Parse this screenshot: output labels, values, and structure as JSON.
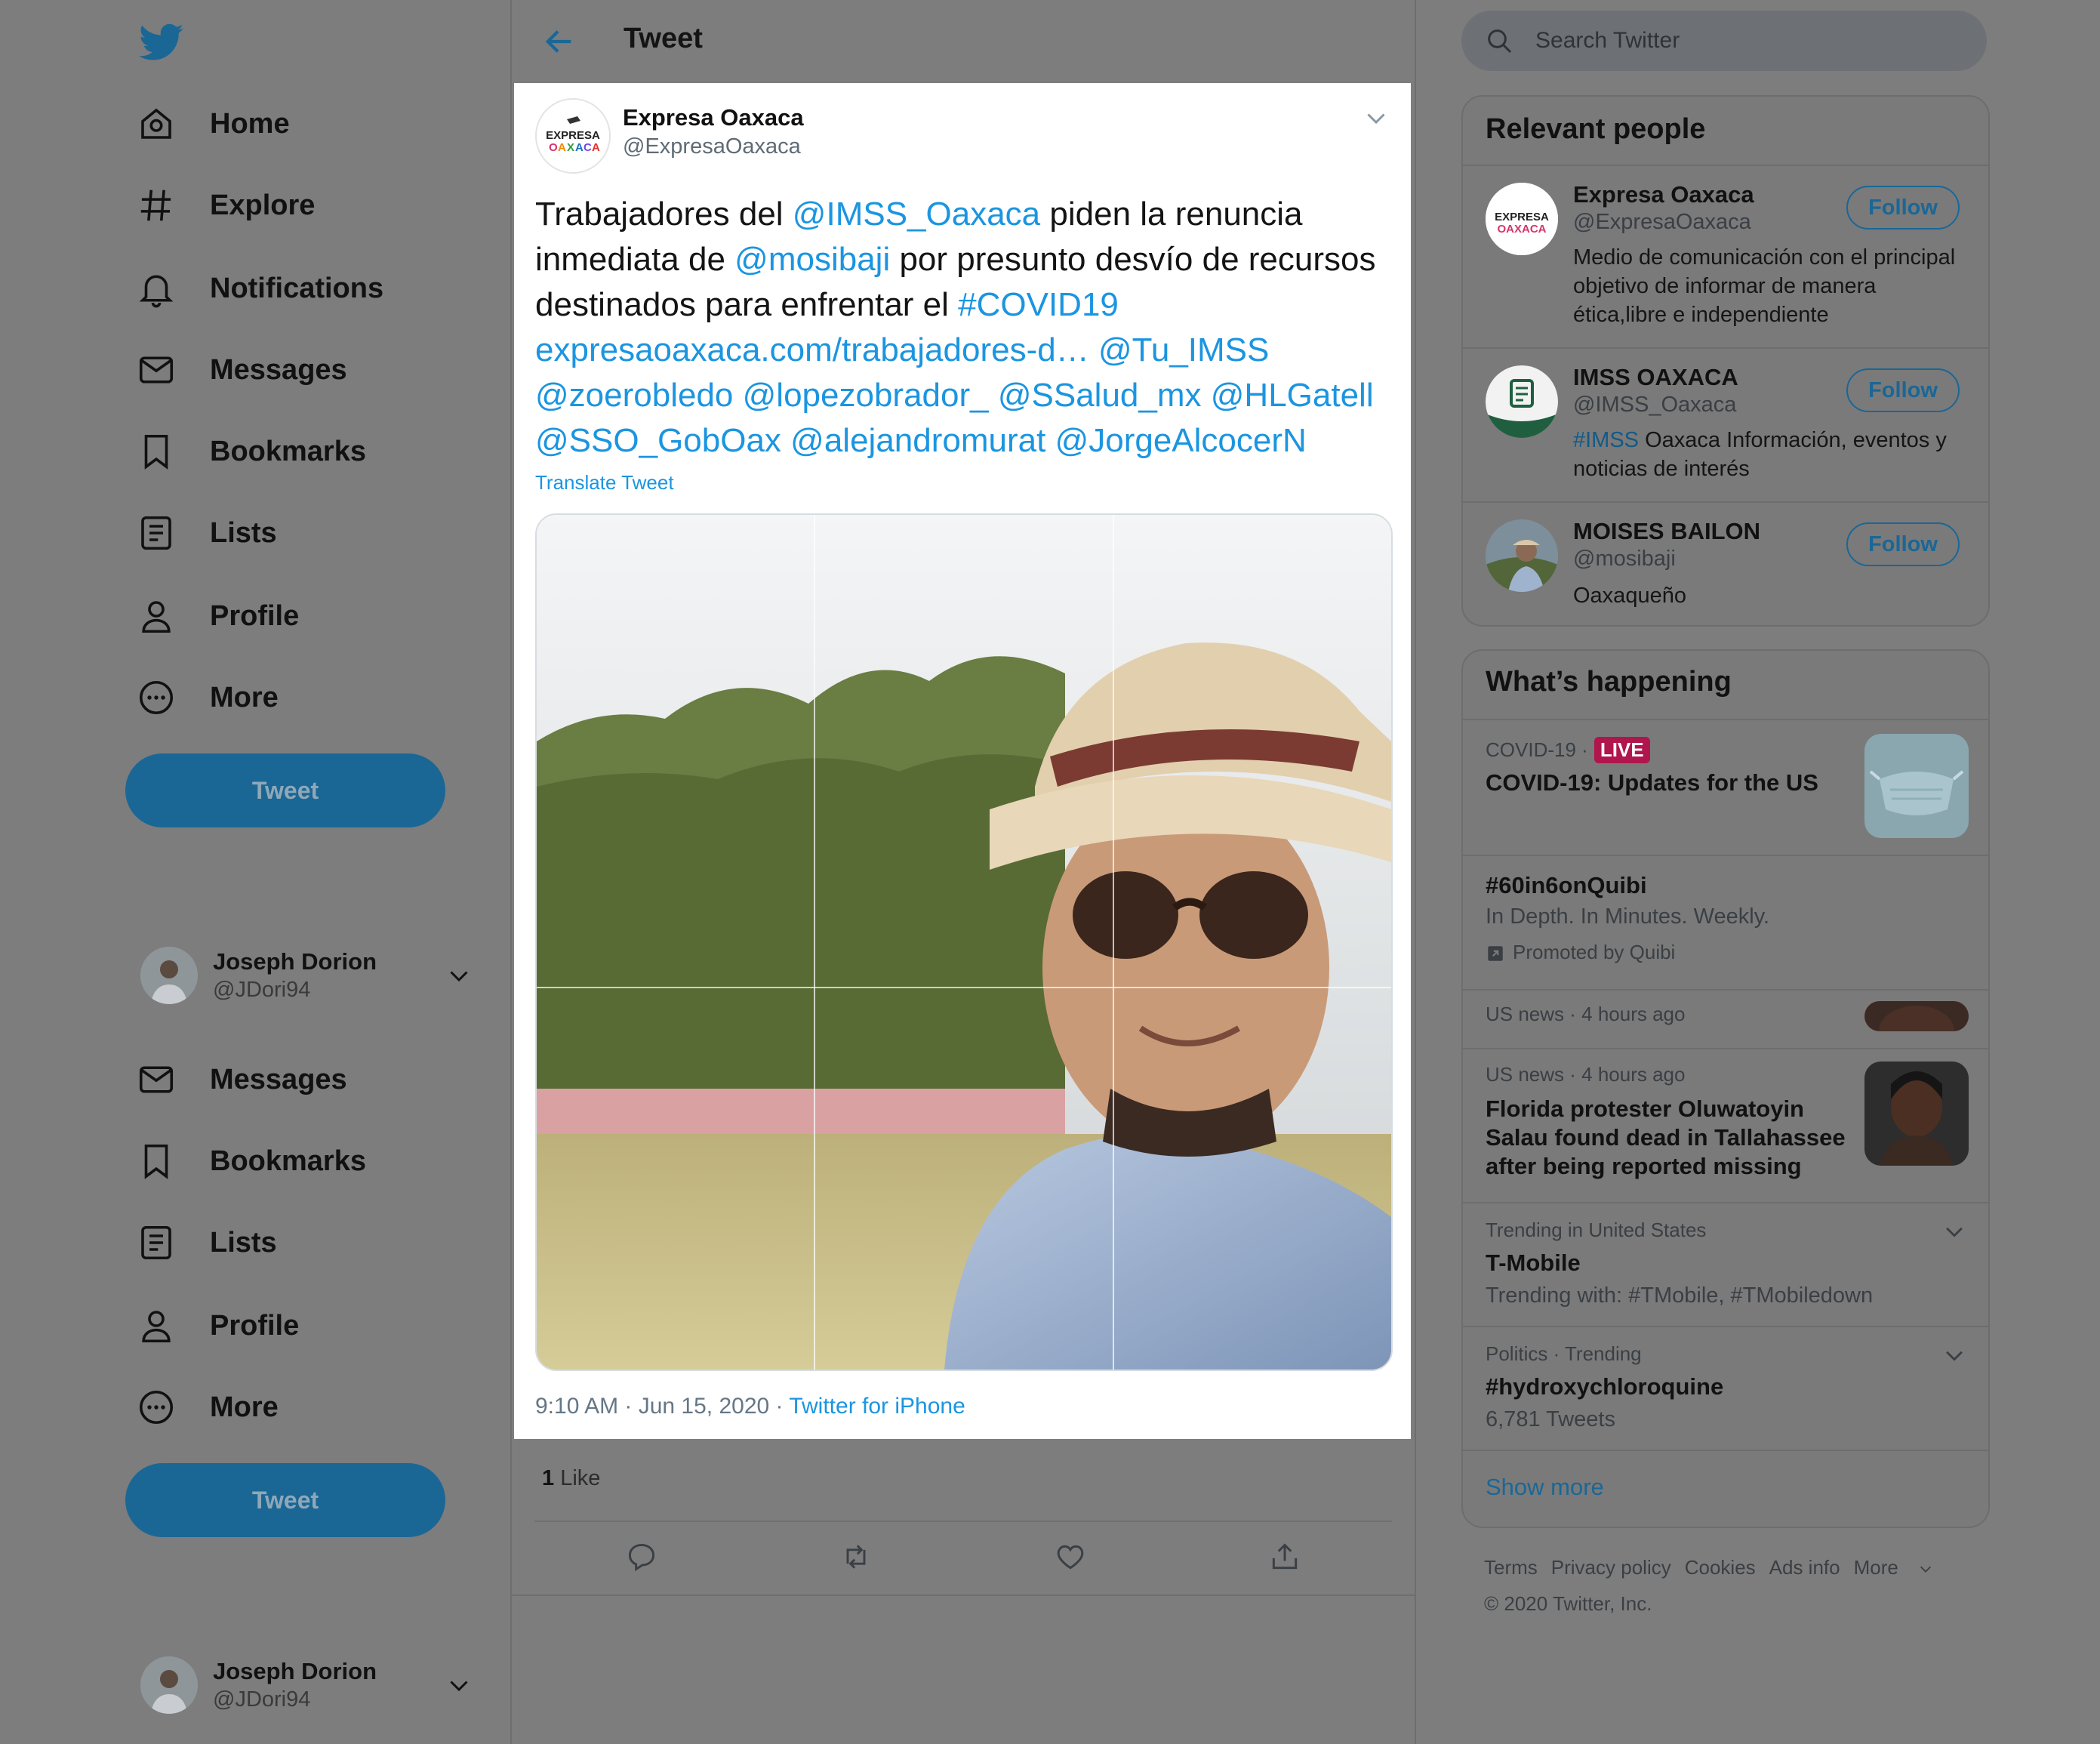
{
  "nav": {
    "items": [
      {
        "label": "Home",
        "icon": "home-icon"
      },
      {
        "label": "Explore",
        "icon": "hashtag-icon"
      },
      {
        "label": "Notifications",
        "icon": "bell-icon"
      },
      {
        "label": "Messages",
        "icon": "mail-icon"
      },
      {
        "label": "Bookmarks",
        "icon": "bookmark-icon"
      },
      {
        "label": "Lists",
        "icon": "list-icon"
      },
      {
        "label": "Profile",
        "icon": "person-icon"
      },
      {
        "label": "More",
        "icon": "more-circle-icon"
      }
    ],
    "items2": [
      {
        "label": "Messages",
        "icon": "mail-icon"
      },
      {
        "label": "Bookmarks",
        "icon": "bookmark-icon"
      },
      {
        "label": "Lists",
        "icon": "list-icon"
      },
      {
        "label": "Profile",
        "icon": "person-icon"
      },
      {
        "label": "More",
        "icon": "more-circle-icon"
      }
    ],
    "tweet_button": "Tweet"
  },
  "account": {
    "name": "Joseph Dorion",
    "handle": "@JDori94"
  },
  "header": {
    "title": "Tweet"
  },
  "tweet": {
    "author_name": "Expresa Oaxaca",
    "author_handle": "@ExpresaOaxaca",
    "text": {
      "p1": "Trabajadores del ",
      "m1": "@IMSS_Oaxaca",
      "p2": " piden la renuncia inmediata de ",
      "m2": "@mosibaji",
      "p3": " por presunto desvío de recursos destinados para enfrentar el ",
      "h1": "#COVID19",
      "url": "expresaoaxaca.com/trabajadores-d…",
      "m3": "@Tu_IMSS",
      "m4": "@zoerobledo",
      "m5": "@lopezobrador_",
      "m6": "@SSalud_mx",
      "m7": "@HLGatell",
      "m8": "@SSO_GobOax",
      "m9": "@alejandromurat",
      "m10": "@JorgeAlcocerN"
    },
    "translate": "Translate Tweet",
    "time": "9:10 AM · Jun 15, 2020",
    "sep": " · ",
    "source": "Twitter for iPhone",
    "likes_count": "1",
    "likes_label": " Like"
  },
  "search": {
    "placeholder": "Search Twitter"
  },
  "relevant": {
    "title": "Relevant people",
    "follow_label": "Follow",
    "people": [
      {
        "name": "Expresa Oaxaca",
        "handle": "@ExpresaOaxaca",
        "bio": "Medio de comunicación con el principal objetivo de informar de manera ética,libre e independiente"
      },
      {
        "name": "IMSS OAXACA",
        "handle": "@IMSS_Oaxaca",
        "bio_tag": "#IMSS",
        "bio": " Oaxaca Información, eventos y noticias de interés"
      },
      {
        "name": "MOISES BAILON",
        "handle": "@mosibaji",
        "bio": "Oaxaqueño"
      }
    ]
  },
  "trends": {
    "title": "What’s happening",
    "items": [
      {
        "context": "COVID-19 ·",
        "badge": "LIVE",
        "title": "COVID-19: Updates for the US"
      },
      {
        "title": "#60in6onQuibi",
        "sub": "In Depth. In Minutes. Weekly.",
        "promoted": "Promoted by Quibi"
      },
      {
        "context": "US news · 4 hours ago"
      },
      {
        "context": "US news · 4 hours ago",
        "title": "Florida protester Oluwatoyin Salau found dead in Tallahassee after being reported missing"
      },
      {
        "context": "Trending in United States",
        "title": "T-Mobile",
        "sub": "Trending with: #TMobile, #TMobiledown"
      },
      {
        "context": "Politics · Trending",
        "title": "#hydroxychloroquine",
        "sub": "6,781 Tweets"
      }
    ],
    "show_more": "Show more"
  },
  "footer": {
    "links": [
      "Terms",
      "Privacy policy",
      "Cookies",
      "Ads info",
      "More"
    ],
    "copyright": "© 2020 Twitter, Inc."
  },
  "colors": {
    "accent": "#1b95e0",
    "dim_accent": "#1a6796",
    "live": "#b0154e",
    "overlay": "#7d7d7d"
  }
}
